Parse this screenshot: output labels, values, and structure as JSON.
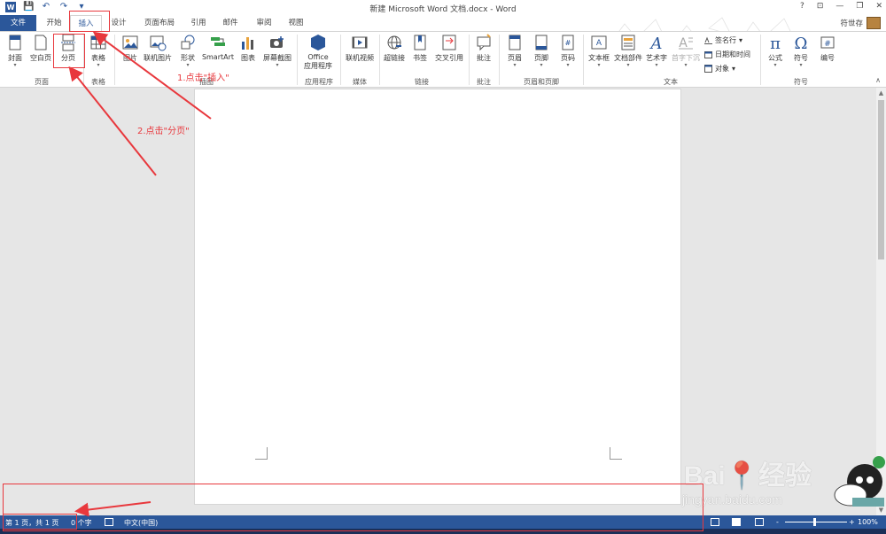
{
  "app": {
    "title": "新建 Microsoft Word 文档.docx - Word",
    "user": "符世存",
    "help": "?",
    "restore_ribbon": "⊡",
    "minimize": "—",
    "maximize": "❐",
    "close": "✕"
  },
  "qat": {
    "word_logo": "W",
    "save": "💾",
    "undo": "↶",
    "redo": "↷",
    "customize": "▾"
  },
  "tabs": [
    {
      "label": "文件"
    },
    {
      "label": "开始"
    },
    {
      "label": "插入"
    },
    {
      "label": "设计"
    },
    {
      "label": "页面布局"
    },
    {
      "label": "引用"
    },
    {
      "label": "邮件"
    },
    {
      "label": "审阅"
    },
    {
      "label": "视图"
    }
  ],
  "active_tab": "插入",
  "ribbon": {
    "cover": "封面",
    "blank_page": "空白页",
    "page_break": "分页",
    "table": "表格",
    "picture": "图片",
    "online_picture": "联机图片",
    "shapes": "形状",
    "smartart": "SmartArt",
    "chart": "图表",
    "screenshot": "屏幕截图",
    "office_line1": "Office",
    "office_line2": "应用程序",
    "online_video": "联机视频",
    "hyperlink": "超链接",
    "bookmark": "书签",
    "cross_ref": "交叉引用",
    "comment": "批注",
    "header": "页眉",
    "footer": "页脚",
    "page_number": "页码",
    "textbox": "文本框",
    "quick_parts": "文档部件",
    "wordart": "艺术字",
    "drop_cap": "首字下沉",
    "signature_line": "签名行",
    "date_time": "日期和时间",
    "object": "对象",
    "equation": "公式",
    "symbol": "符号",
    "number": "编号",
    "dropdown": "▾",
    "collapse": "∧"
  },
  "groups": {
    "pages": "页面",
    "tables": "表格",
    "illustrations": "插图",
    "apps": "应用程序",
    "media": "媒体",
    "links": "链接",
    "comments": "批注",
    "header_footer": "页眉和页脚",
    "text": "文本",
    "symbols": "符号"
  },
  "annotations": {
    "step1": "1.点击\"插入\"",
    "step2": "2.点击\"分页\""
  },
  "status": {
    "page": "第 1 页，共 1 页",
    "words": "0 个字",
    "language": "中文(中国)",
    "zoom": "100%",
    "zoom_minus": "-",
    "zoom_plus": "+"
  },
  "watermark": {
    "baidu": "Bai📍经验",
    "site": "jingyan.baidu.com"
  },
  "colors": {
    "accent": "#2b579a",
    "annotation": "#e8383d"
  }
}
